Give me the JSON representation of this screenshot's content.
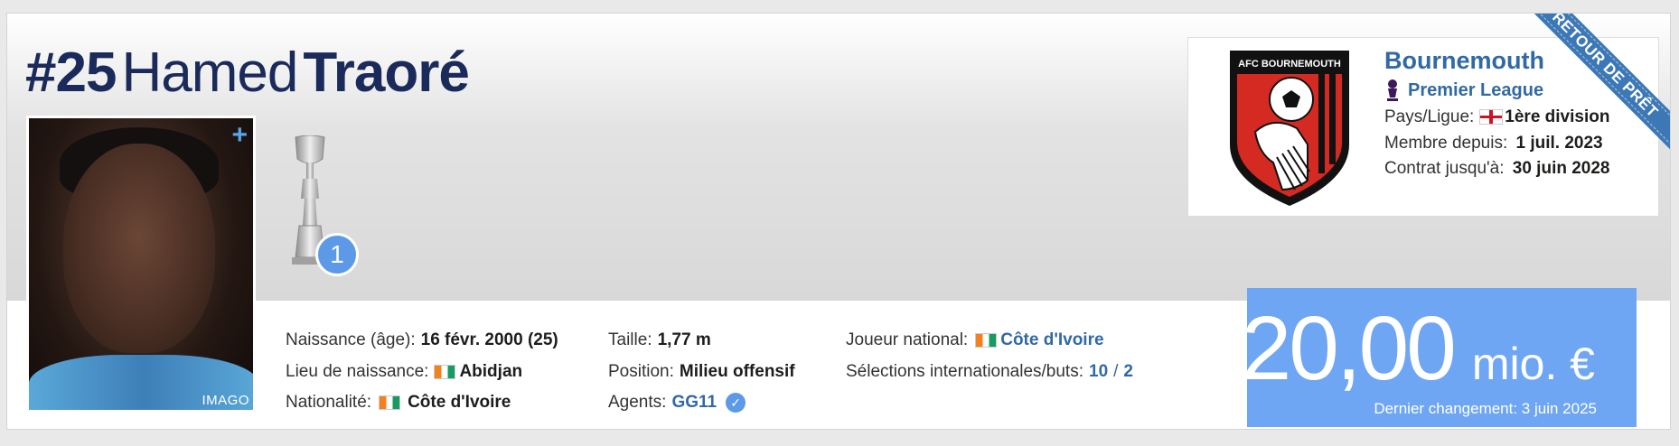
{
  "player": {
    "number": "#25",
    "first_name": "Hamed",
    "last_name": "Traoré",
    "photo_credit": "IMAGO",
    "photo_action": "+"
  },
  "trophy": {
    "count": "1"
  },
  "ribbon": {
    "label": "RETOUR DE PRÊT"
  },
  "details": {
    "col1": [
      {
        "label": "Naissance (âge):",
        "value": "16 févr. 2000 (25)"
      },
      {
        "label": "Lieu de naissance:",
        "value": "Abidjan",
        "flag": "ci"
      },
      {
        "label": "Nationalité:",
        "value": "Côte d'Ivoire",
        "flag": "ci"
      }
    ],
    "col2": [
      {
        "label": "Taille:",
        "value": "1,77 m"
      },
      {
        "label": "Position:",
        "value": "Milieu offensif"
      },
      {
        "label": "Agents:",
        "value": "GG11",
        "verified_icon": "check-icon"
      }
    ],
    "col3": [
      {
        "label": "Joueur national:",
        "value": "Côte d'Ivoire",
        "flag": "ci"
      },
      {
        "label": "Sélections internationales/buts:",
        "caps": "10",
        "separator": "/",
        "goals": "2"
      }
    ]
  },
  "club": {
    "name": "Bournemouth",
    "league": "Premier League",
    "logo_text": "AFC BOURNEMOUTH",
    "rows": [
      {
        "label": "Pays/Ligue:",
        "value": "1ère division",
        "flag": "en"
      },
      {
        "label": "Membre depuis:",
        "value": "1 juil. 2023"
      },
      {
        "label": "Contrat jusqu'à:",
        "value": "30 juin 2028"
      }
    ]
  },
  "market_value": {
    "amount": "20,00",
    "unit": "mio. €",
    "last_change": "Dernier changement: 3 juin 2025"
  },
  "colors": {
    "accent": "#3169a5",
    "market_value_bg": "#6ea6f4",
    "ribbon": "#3d78b6",
    "title": "#1a2a5a"
  }
}
